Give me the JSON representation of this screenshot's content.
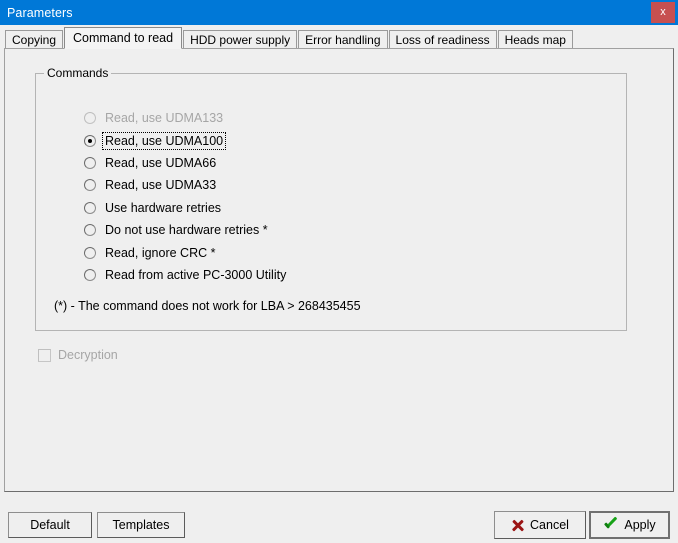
{
  "window": {
    "title": "Parameters",
    "close_label": "x",
    "close_icon": "close-icon"
  },
  "tabs": [
    {
      "label": "Copying",
      "active": false
    },
    {
      "label": "Command to read",
      "active": true
    },
    {
      "label": "HDD power supply",
      "active": false
    },
    {
      "label": "Error handling",
      "active": false
    },
    {
      "label": "Loss of readiness",
      "active": false
    },
    {
      "label": "Heads map",
      "active": false
    }
  ],
  "commands_group": {
    "legend": "Commands",
    "options": [
      {
        "label": "Read, use UDMA133",
        "checked": false,
        "disabled": true,
        "focused": false
      },
      {
        "label": "Read, use UDMA100",
        "checked": true,
        "disabled": false,
        "focused": true
      },
      {
        "label": "Read, use UDMA66",
        "checked": false,
        "disabled": false,
        "focused": false
      },
      {
        "label": "Read, use UDMA33",
        "checked": false,
        "disabled": false,
        "focused": false
      },
      {
        "label": "Use hardware retries",
        "checked": false,
        "disabled": false,
        "focused": false
      },
      {
        "label": "Do not use hardware retries *",
        "checked": false,
        "disabled": false,
        "focused": false
      },
      {
        "label": "Read, ignore CRC *",
        "checked": false,
        "disabled": false,
        "focused": false
      },
      {
        "label": "Read from active PC-3000 Utility",
        "checked": false,
        "disabled": false,
        "focused": false
      }
    ],
    "footnote": "(*) - The command does not work for LBA > 268435455"
  },
  "decryption": {
    "label": "Decryption",
    "checked": false,
    "disabled": true
  },
  "buttons": {
    "default": "Default",
    "templates": "Templates",
    "cancel": "Cancel",
    "apply": "Apply",
    "cancel_icon": "x-mark-icon",
    "apply_icon": "check-mark-icon"
  },
  "colors": {
    "titlebar": "#0078d7",
    "close_button": "#c75050",
    "dialog_background": "#efefef",
    "cancel_icon": "#9b1414",
    "apply_icon": "#17a217",
    "disabled_text": "#a6a6a6"
  }
}
